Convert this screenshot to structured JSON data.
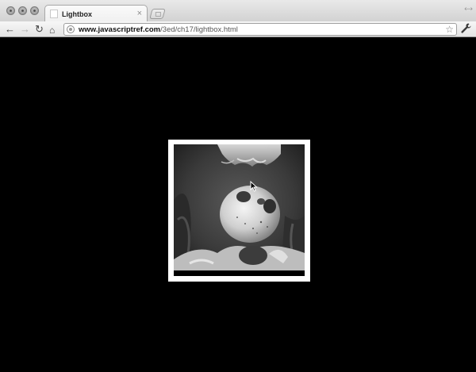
{
  "window": {
    "tab_title": "Lightbox",
    "tab_close": "×"
  },
  "toolbar": {
    "back_icon": "←",
    "forward_icon": "→",
    "reload_icon": "↻",
    "home_icon": "⌂",
    "url_host": "www.javascriptref.com",
    "url_path": "/3ed/ch17/lightbox.html",
    "star_icon": "☆",
    "wrench_icon": "🔧"
  },
  "page": {
    "background": "#000000",
    "lightbox": {
      "frame_color": "#ffffff",
      "image_subject": "black-and-white photo of a pufferfish underwater"
    }
  }
}
